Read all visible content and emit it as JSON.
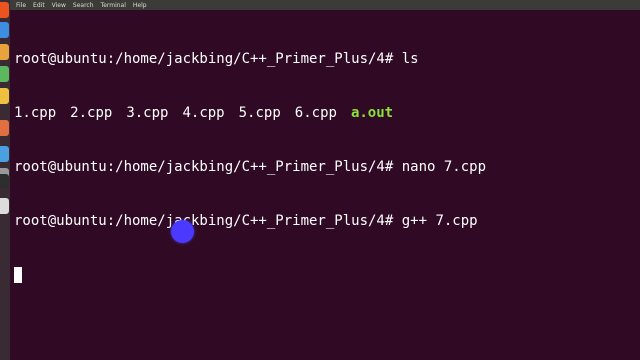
{
  "menubar": {
    "items": [
      "File",
      "Edit",
      "View",
      "Search",
      "Terminal",
      "Help"
    ]
  },
  "launcher": {
    "apps": [
      {
        "icon": "dash-icon",
        "color": "#e95420"
      },
      {
        "icon": "files-icon",
        "color": "#3d8ee0"
      },
      {
        "icon": "browser-icon",
        "color": "#e8a33d"
      },
      {
        "icon": "office-icon",
        "color": "#5cb85c"
      },
      {
        "icon": "text-icon",
        "color": "#f0c040"
      },
      {
        "icon": "software-icon",
        "color": "#e07040"
      },
      {
        "icon": "web-icon",
        "color": "#4aa0e0"
      },
      {
        "icon": "settings-icon",
        "color": "#9a9a9a"
      },
      {
        "icon": "terminal-icon",
        "color": "#2e2e2e"
      },
      {
        "icon": "disk-icon",
        "color": "#dcdcdc"
      }
    ]
  },
  "terminal": {
    "line1": {
      "prompt": "root@ubuntu:/home/jackbing/C++_Primer_Plus/4#",
      "command": " ls"
    },
    "listing": [
      "1.cpp",
      "2.cpp",
      "3.cpp",
      "4.cpp",
      "5.cpp",
      "6.cpp"
    ],
    "listing_exec": "a.out",
    "line3": {
      "prompt": "root@ubuntu:/home/jackbing/C++_Primer_Plus/4#",
      "command": " nano 7.cpp"
    },
    "line4": {
      "prompt": "root@ubuntu:/home/jackbing/C++_Primer_Plus/4#",
      "command": " g++ 7.cpp"
    }
  },
  "colors": {
    "background": "#300a24",
    "text": "#ffffff",
    "executable": "#8ae234",
    "pointer": "#4a3aff"
  }
}
